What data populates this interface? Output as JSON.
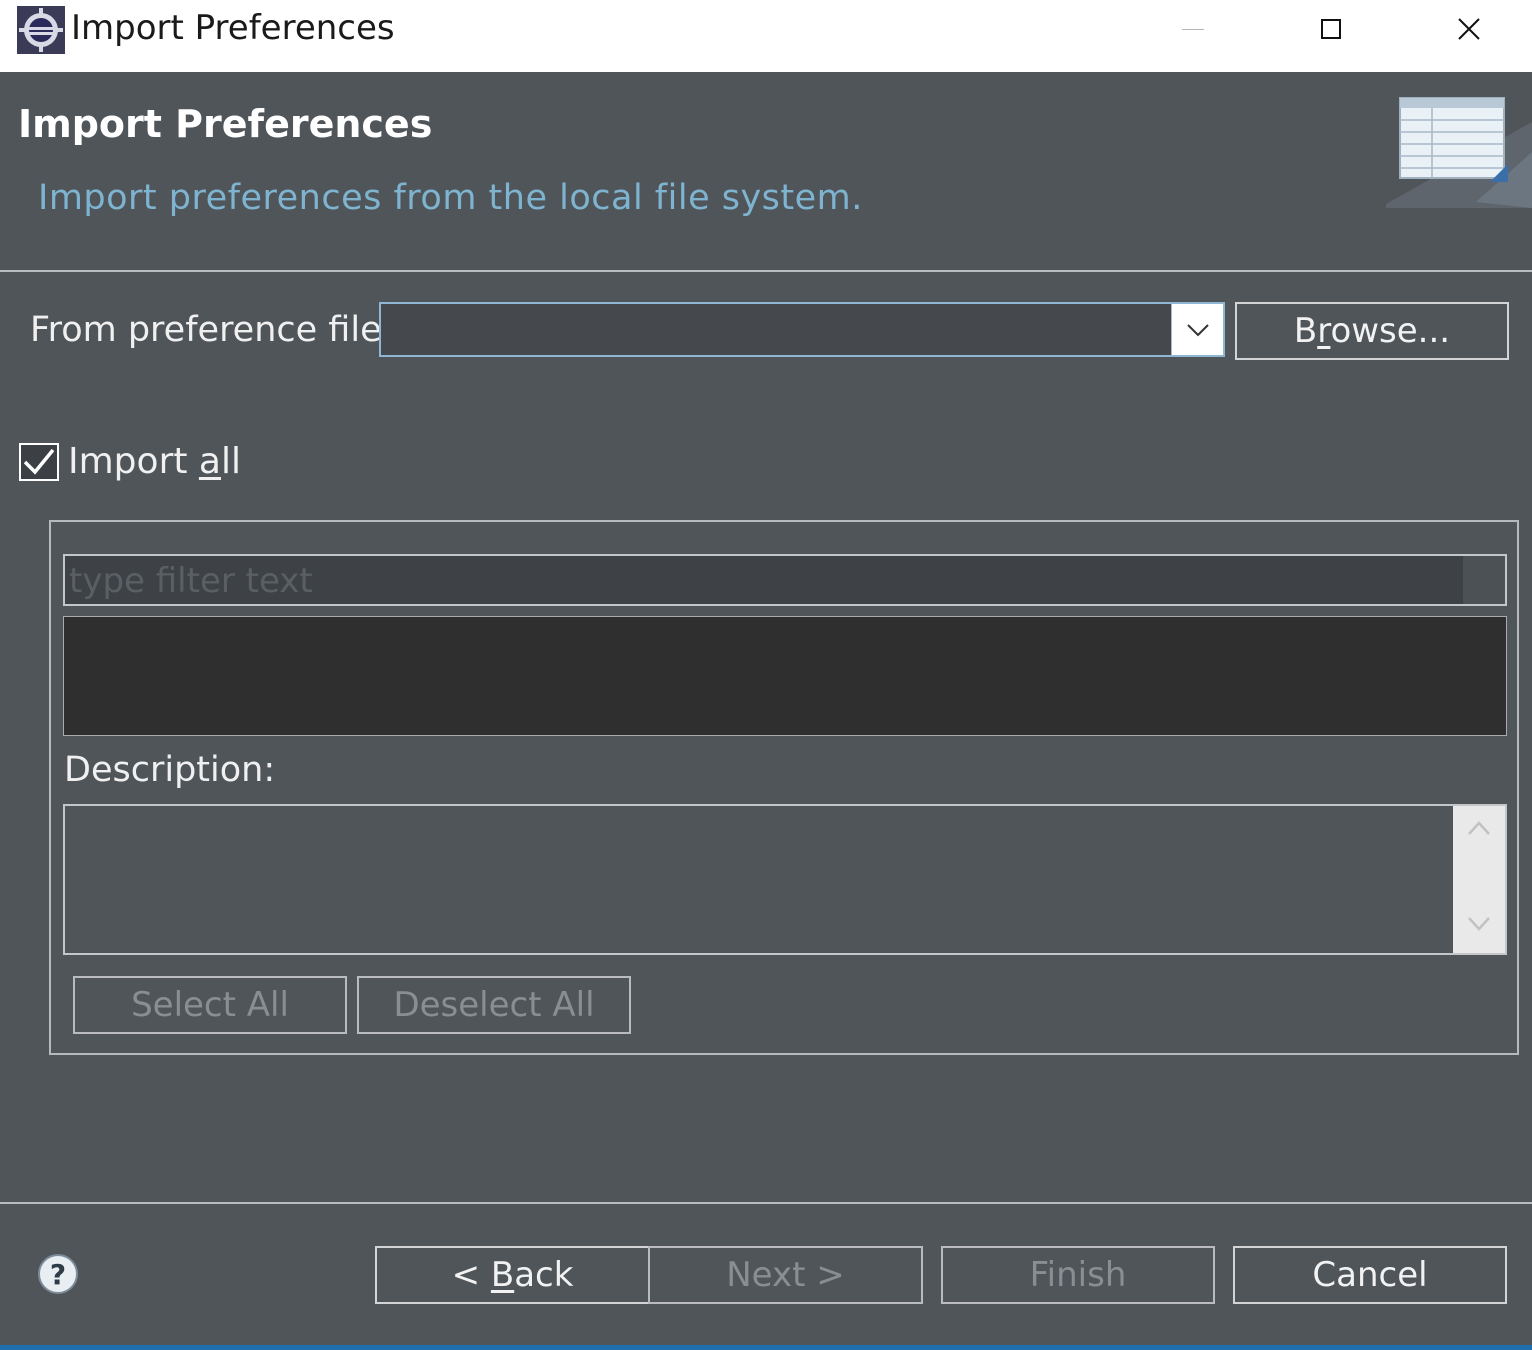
{
  "window": {
    "title": "Import Preferences",
    "controls": {
      "minimize": "minimize-icon",
      "maximize": "maximize-icon",
      "close": "close-icon"
    }
  },
  "header": {
    "title": "Import Preferences",
    "description": "Import preferences from the local file system.",
    "banner_icon": "preferences-table-icon"
  },
  "from_file": {
    "label": "From preference file:",
    "value": "",
    "browse_label": "Browse...",
    "browse_mnemonic": "r"
  },
  "import_all": {
    "label_prefix": "Import ",
    "label_mnemonic": "a",
    "label_suffix": "ll",
    "checked": true
  },
  "filter": {
    "placeholder": "type filter text"
  },
  "description": {
    "label": "Description:",
    "text": ""
  },
  "selection_buttons": {
    "select_all": "Select All",
    "deselect_all": "Deselect All"
  },
  "footer": {
    "help_icon": "help-icon",
    "back_prefix": "< ",
    "back_mnemonic": "B",
    "back_suffix": "ack",
    "next_label": "Next >",
    "finish_label": "Finish",
    "cancel_label": "Cancel"
  },
  "colors": {
    "background": "#50555a",
    "header_description": "#7fb4d0",
    "accent": "#1f6fae",
    "disabled_text": "#8a8e92"
  }
}
